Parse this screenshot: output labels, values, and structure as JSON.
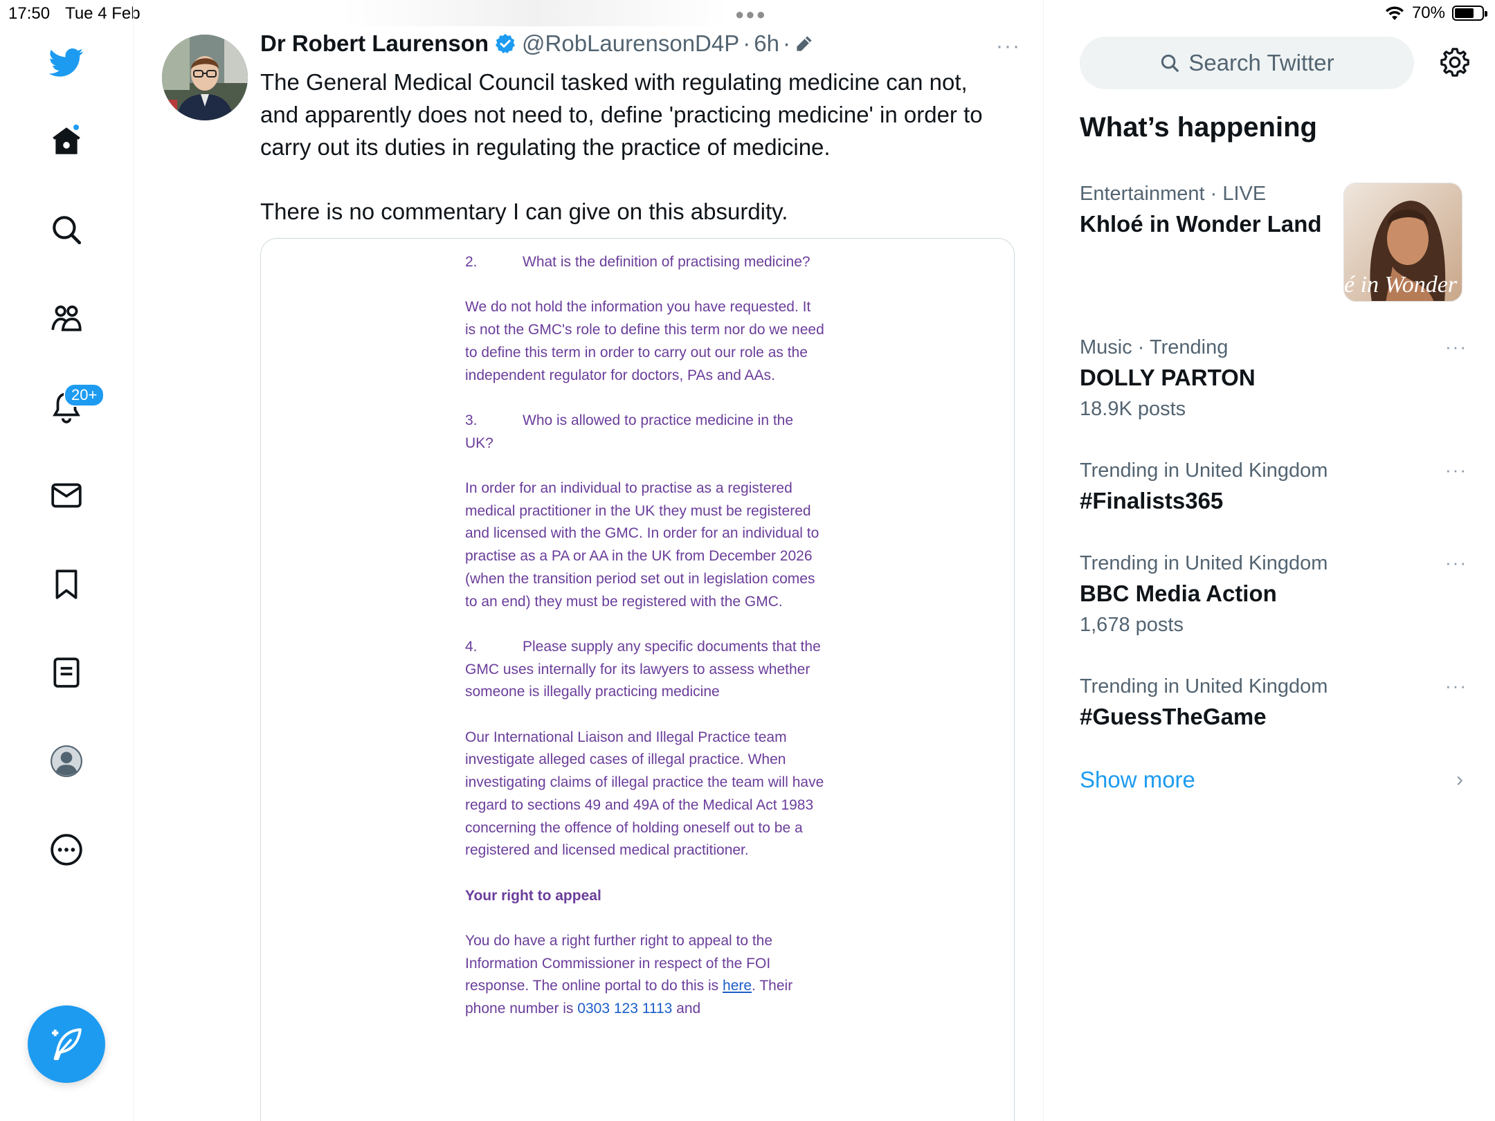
{
  "status_bar": {
    "time": "17:50",
    "date": "Tue 4 Feb",
    "battery": "70%",
    "battery_level": 0.7
  },
  "nav": {
    "notifications_badge": "20+"
  },
  "tweet": {
    "author_name": "Dr Robert Laurenson",
    "handle": "@RobLaurensonD4P",
    "separator": "·",
    "time": "6h",
    "more": "···",
    "text_p1": "The General Medical Council tasked with regulating medicine can not, and apparently does not need to, define 'practicing medicine' in order to carry out its duties in regulating the practice of medicine.",
    "text_p2": "There is no commentary I can give on this absurdity."
  },
  "document": {
    "q2_num": "2.",
    "q2_text": "What is the definition of practising medicine?",
    "a2": "We do not hold the information you have requested. It is not the GMC's role to define this term nor do we need to define this term in order to carry out our role as the independent regulator for doctors, PAs and AAs.",
    "q3_num": "3.",
    "q3_text": "Who is allowed to practice medicine in the UK?",
    "a3": "In order for an individual to practise as a registered medical practitioner in the UK they must be registered and licensed with the GMC. In order for an individual to practise as a PA or AA in the UK from December 2026 (when the transition period set out in legislation comes to an end) they must be registered with the GMC.",
    "q4_num": "4.",
    "q4_text": "Please supply any specific documents that the GMC uses internally for its lawyers to assess whether someone is illegally practicing medicine",
    "a4": "Our International Liaison and Illegal Practice team investigate alleged cases of illegal practice. When investigating claims of illegal practice the team will have regard to sections 49 and 49A of the Medical Act 1983 concerning the offence of holding oneself out to be a registered and licensed medical practitioner.",
    "appeal_heading": "Your right to appeal",
    "appeal_text": "You do have a right further right to appeal to the Information Commissioner in respect of the FOI response. The online portal to do this is",
    "appeal_link": "here",
    "phone_prefix": "Their phone number is",
    "phone_number": "0303 123 1113",
    "phone_suffix": "and"
  },
  "sidebar": {
    "search_placeholder": "Search Twitter",
    "whats_happening": "What’s happening",
    "trends": [
      {
        "category": "Entertainment",
        "extra": "LIVE",
        "name": "Khloé in Wonder Land",
        "posts": ""
      },
      {
        "category": "Music · Trending",
        "name": "DOLLY PARTON",
        "posts": "18.9K posts"
      },
      {
        "category": "Trending in United Kingdom",
        "name": "#Finalists365",
        "posts": ""
      },
      {
        "category": "Trending in United Kingdom",
        "name": "BBC Media Action",
        "posts": "1,678 posts"
      },
      {
        "category": "Trending in United Kingdom",
        "name": "#GuessTheGame",
        "posts": ""
      }
    ],
    "trend_image_caption": "é in Wonder L",
    "more_dots": "···",
    "show_more": "Show more",
    "chevron": "›"
  },
  "colors": {
    "accent": "#1d9bf0",
    "document_text": "#6a3d9a"
  }
}
